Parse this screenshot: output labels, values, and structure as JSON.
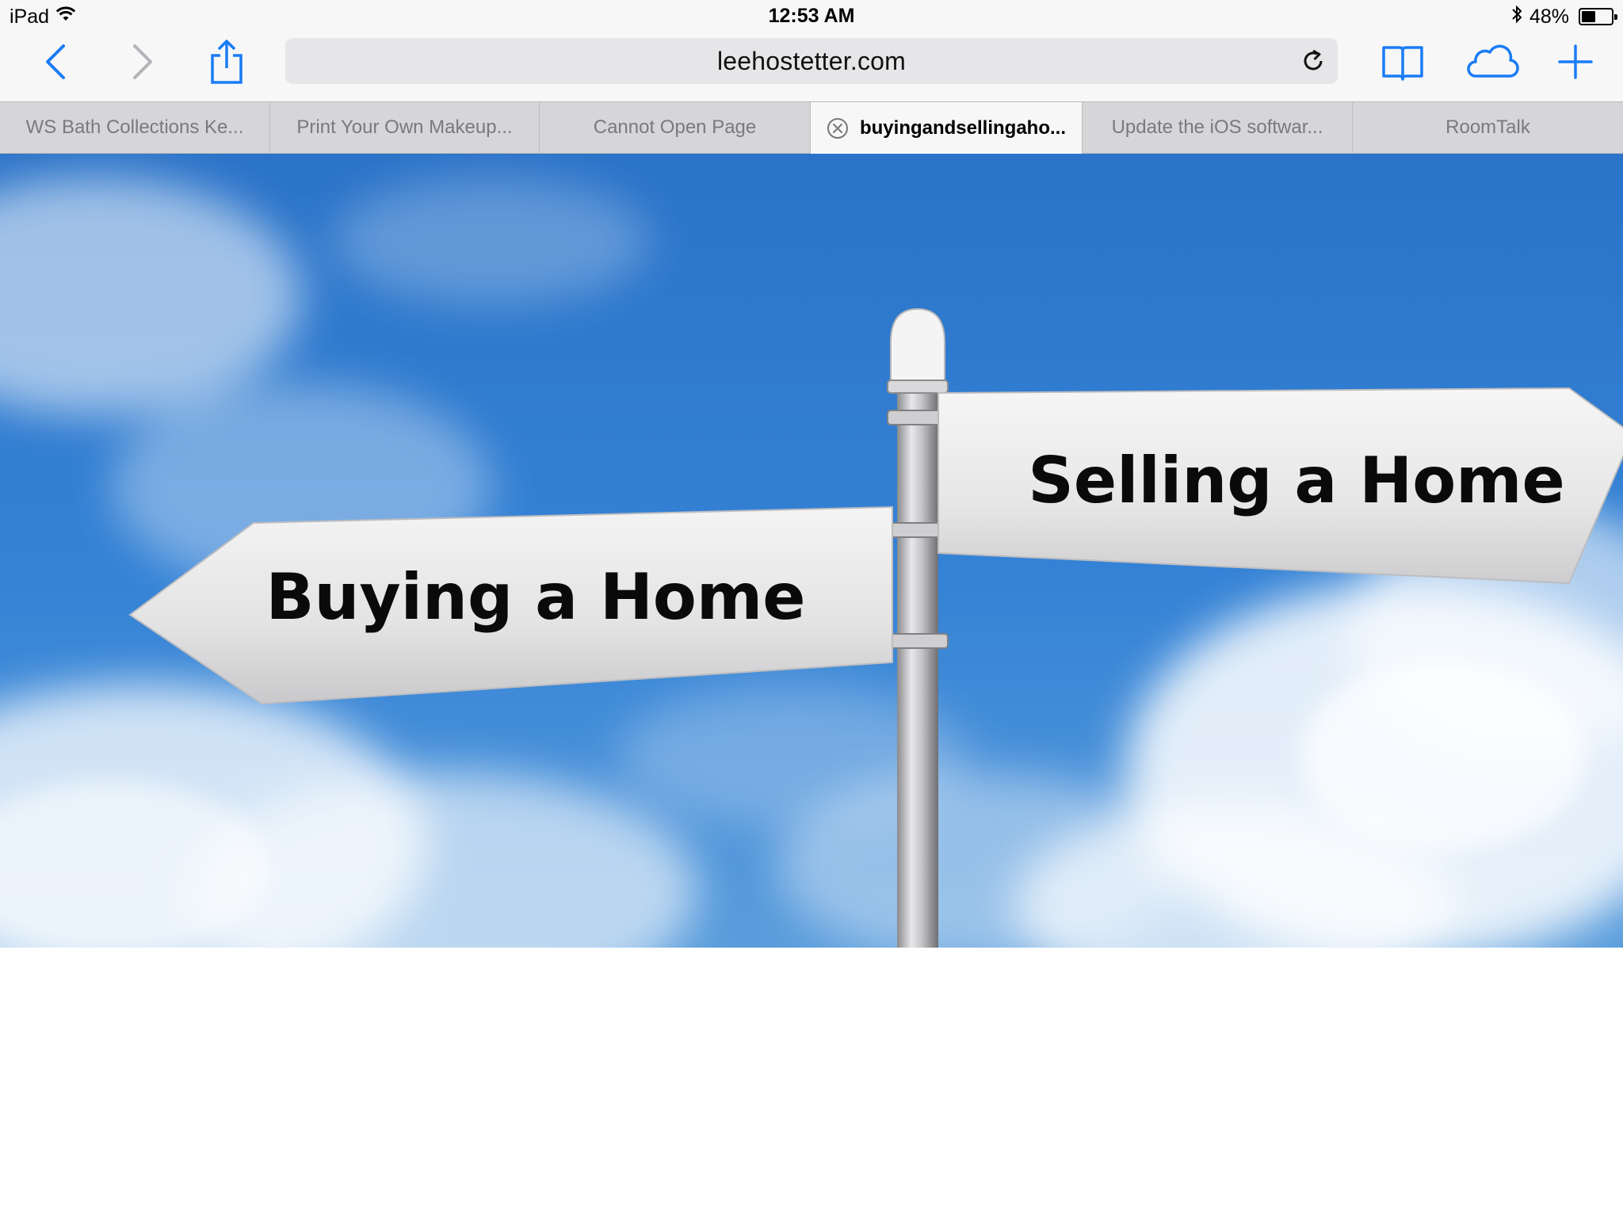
{
  "status_bar": {
    "device": "iPad",
    "time": "12:53 AM",
    "battery_percent": "48%",
    "battery_level": 0.48,
    "icons": [
      "wifi-icon",
      "bluetooth-icon",
      "battery-icon"
    ]
  },
  "toolbar": {
    "address": "leehostetter.com",
    "buttons": [
      "back-button",
      "forward-button",
      "share-button",
      "bookmarks-button",
      "icloud-tabs-button",
      "new-tab-button"
    ],
    "accent_color": "#1a7cf5"
  },
  "tabs": [
    {
      "title": "WS Bath Collections Ke..."
    },
    {
      "title": "Print Your Own Makeup..."
    },
    {
      "title": "Cannot Open Page"
    },
    {
      "title": "buyingandsellingaho...",
      "active": true
    },
    {
      "title": "Update the iOS softwar..."
    },
    {
      "title": "RoomTalk"
    }
  ],
  "page": {
    "hero_image": {
      "sign_left": "Buying a Home",
      "sign_right": "Selling a Home"
    },
    "sky_color": "#2f7fd2"
  }
}
